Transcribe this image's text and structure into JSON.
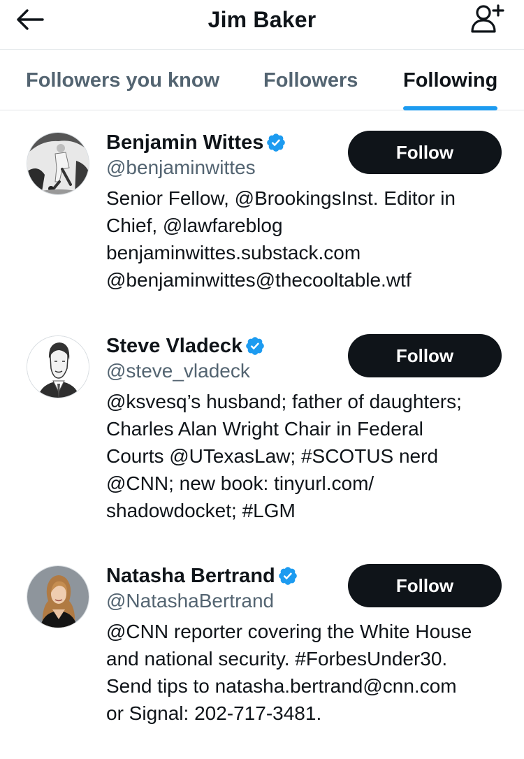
{
  "header": {
    "title": "Jim Baker",
    "back_icon": "arrow-left-icon",
    "add_icon": "add-user-icon"
  },
  "tabs": [
    {
      "label": "Followers you know",
      "active": false
    },
    {
      "label": "Followers",
      "active": false
    },
    {
      "label": "Following",
      "active": true
    }
  ],
  "accent_color": "#1d9bf0",
  "users": [
    {
      "name": "Benjamin Wittes",
      "handle": "@benjaminwittes",
      "verified": true,
      "follow_label": "Follow",
      "bio_lines": [
        "Senior Fellow, @BrookingsInst. Editor in",
        "Chief, @lawfareblog",
        "benjaminwittes.substack.com",
        "@benjaminwittes@thecooltable.wtf"
      ]
    },
    {
      "name": "Steve Vladeck",
      "handle": "@steve_vladeck",
      "verified": true,
      "follow_label": "Follow",
      "bio_lines": [
        "@ksvesq’s husband; father of daughters;",
        "Charles Alan Wright Chair in Federal",
        "Courts @UTexasLaw; #SCOTUS nerd",
        "@CNN; new book: tinyurl.com/",
        "shadowdocket; #LGM"
      ]
    },
    {
      "name": "Natasha Bertrand",
      "handle": "@NatashaBertrand",
      "verified": true,
      "follow_label": "Follow",
      "bio_lines": [
        "@CNN reporter covering the White House",
        "and national security. #ForbesUnder30.",
        "Send tips to natasha.bertrand@cnn.com",
        "or Signal: 202-717-3481."
      ]
    }
  ]
}
